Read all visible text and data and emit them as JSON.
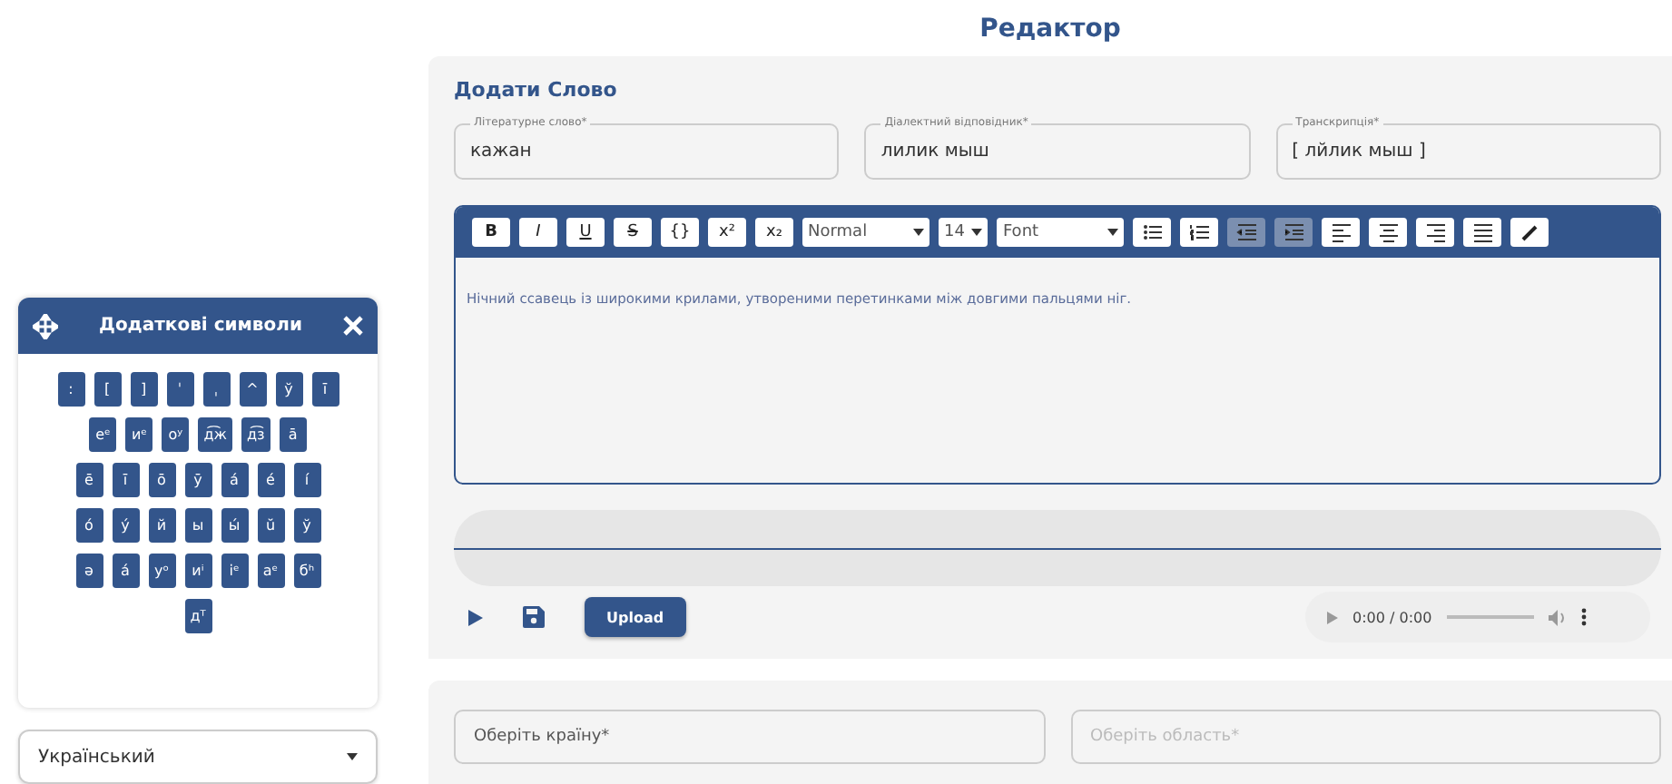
{
  "symbols_panel": {
    "title": "Додаткові символи",
    "key_lines": [
      [
        ":",
        "[",
        "]",
        "ˈ",
        "ˌ",
        "^",
        "ў",
        "ī"
      ],
      [
        "еᵉ",
        "иᵉ",
        "оʸ",
        "д͡ж",
        "д͡з",
        "ā"
      ],
      [
        "ē",
        "ī",
        "ō",
        "ӯ",
        "а́",
        "е́",
        "і́"
      ],
      [
        "ó",
        "ý",
        "й",
        "ы",
        "ы́",
        "ŭ",
        "ў"
      ],
      [
        "ə",
        "á",
        "уᵒ",
        "иⁱ",
        "іᵉ",
        "aᵉ",
        "бʰ"
      ],
      [
        "дᵀ"
      ]
    ],
    "language": {
      "value": "Український"
    }
  },
  "page_title": "Редактор",
  "word_card": {
    "title": "Додати Слово",
    "fields": [
      {
        "label": "Літературне слово*",
        "value": "кажан"
      },
      {
        "label": "Діалектний відповідник*",
        "value": "лилик мыш"
      },
      {
        "label": "Транскрипція*",
        "value": "[ лйлик мыш ]"
      }
    ],
    "toolbar": [
      {
        "kind": "text",
        "label": "B",
        "active": false
      },
      {
        "kind": "text",
        "label": "I",
        "active": false
      },
      {
        "kind": "text",
        "label": "U",
        "active": false
      },
      {
        "kind": "text",
        "label": "S",
        "active": false
      },
      {
        "kind": "text",
        "label": "{}",
        "active": false
      },
      {
        "kind": "text",
        "label": "x²",
        "active": false
      },
      {
        "kind": "text",
        "label": "x₂",
        "active": false
      },
      {
        "kind": "select",
        "label": "Normal",
        "active": false
      },
      {
        "kind": "select",
        "label": "14",
        "active": false
      },
      {
        "kind": "select",
        "label": "Font",
        "active": false
      },
      {
        "kind": "bullet-list",
        "active": false
      },
      {
        "kind": "ordered-list",
        "active": false
      },
      {
        "kind": "outdent",
        "active": true
      },
      {
        "kind": "indent",
        "active": true
      },
      {
        "kind": "align-left",
        "active": false
      },
      {
        "kind": "align-center",
        "active": false
      },
      {
        "kind": "align-right",
        "active": false
      },
      {
        "kind": "justify",
        "active": false
      },
      {
        "kind": "pen",
        "active": false
      }
    ],
    "editor_text": "Нічний ссавець із широкими крилами, утвореними перетинками між довгими пальцями ніг.",
    "recorder": {
      "upload_label": "Upload",
      "player": {
        "time": "0:00 / 0:00"
      }
    }
  },
  "location_card": {
    "fields": [
      {
        "placeholder": "Оберіть країну*",
        "disabled": false
      },
      {
        "placeholder": "Оберіть область*",
        "disabled": true
      }
    ]
  }
}
